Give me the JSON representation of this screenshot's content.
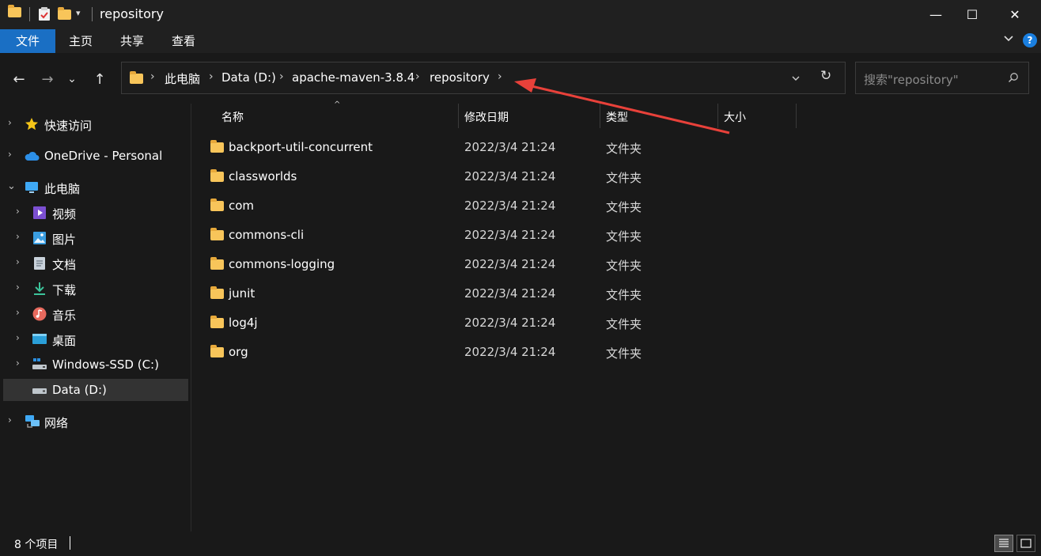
{
  "window": {
    "title": "repository",
    "buttons": {
      "minimize": "—",
      "maximize": "☐",
      "close": "✕"
    }
  },
  "ribbon": {
    "tabs": [
      "文件",
      "主页",
      "共享",
      "查看"
    ],
    "collapse_icon": "chevron-down-icon",
    "help_icon": "?"
  },
  "nav": {
    "back": "←",
    "forward": "→",
    "recent": "⌄",
    "up": "↑",
    "breadcrumb": [
      "此电脑",
      "Data (D:)",
      "apache-maven-3.8.4",
      "repository"
    ],
    "separator": "›",
    "dropdown": "⌄",
    "refresh": "↻"
  },
  "search": {
    "placeholder": "搜索\"repository\"",
    "icon": "search-icon"
  },
  "sidebar": {
    "items": [
      {
        "label": "快速访问",
        "icon": "star-icon",
        "level": 0,
        "expand": "›"
      },
      {
        "label": "OneDrive - Personal",
        "icon": "cloud-icon",
        "level": 0,
        "expand": "›"
      },
      {
        "label": "此电脑",
        "icon": "computer-icon",
        "level": 0,
        "expand": "⌄"
      },
      {
        "label": "视频",
        "icon": "video-icon",
        "level": 1,
        "expand": "›"
      },
      {
        "label": "图片",
        "icon": "pictures-icon",
        "level": 1,
        "expand": "›"
      },
      {
        "label": "文档",
        "icon": "documents-icon",
        "level": 1,
        "expand": "›"
      },
      {
        "label": "下载",
        "icon": "download-icon",
        "level": 1,
        "expand": "›"
      },
      {
        "label": "音乐",
        "icon": "music-icon",
        "level": 1,
        "expand": "›"
      },
      {
        "label": "桌面",
        "icon": "desktop-icon",
        "level": 1,
        "expand": "›"
      },
      {
        "label": "Windows-SSD (C:)",
        "icon": "drive-icon",
        "level": 1,
        "expand": "›"
      },
      {
        "label": "Data (D:)",
        "icon": "drive-icon",
        "level": 1,
        "expand": "",
        "selected": true
      },
      {
        "label": "网络",
        "icon": "network-icon",
        "level": 0,
        "expand": "›"
      }
    ]
  },
  "columns": {
    "name": "名称",
    "date": "修改日期",
    "type": "类型",
    "size": "大小",
    "sort_indicator": "^"
  },
  "files": [
    {
      "name": "backport-util-concurrent",
      "date": "2022/3/4 21:24",
      "type": "文件夹"
    },
    {
      "name": "classworlds",
      "date": "2022/3/4 21:24",
      "type": "文件夹"
    },
    {
      "name": "com",
      "date": "2022/3/4 21:24",
      "type": "文件夹"
    },
    {
      "name": "commons-cli",
      "date": "2022/3/4 21:24",
      "type": "文件夹"
    },
    {
      "name": "commons-logging",
      "date": "2022/3/4 21:24",
      "type": "文件夹"
    },
    {
      "name": "junit",
      "date": "2022/3/4 21:24",
      "type": "文件夹"
    },
    {
      "name": "log4j",
      "date": "2022/3/4 21:24",
      "type": "文件夹"
    },
    {
      "name": "org",
      "date": "2022/3/4 21:24",
      "type": "文件夹"
    }
  ],
  "status": {
    "count": "8 个项目"
  },
  "colors": {
    "accent": "#1a6fc4",
    "folder": "#f8c55a",
    "annotation_arrow": "#e8413a",
    "background": "#191919"
  }
}
